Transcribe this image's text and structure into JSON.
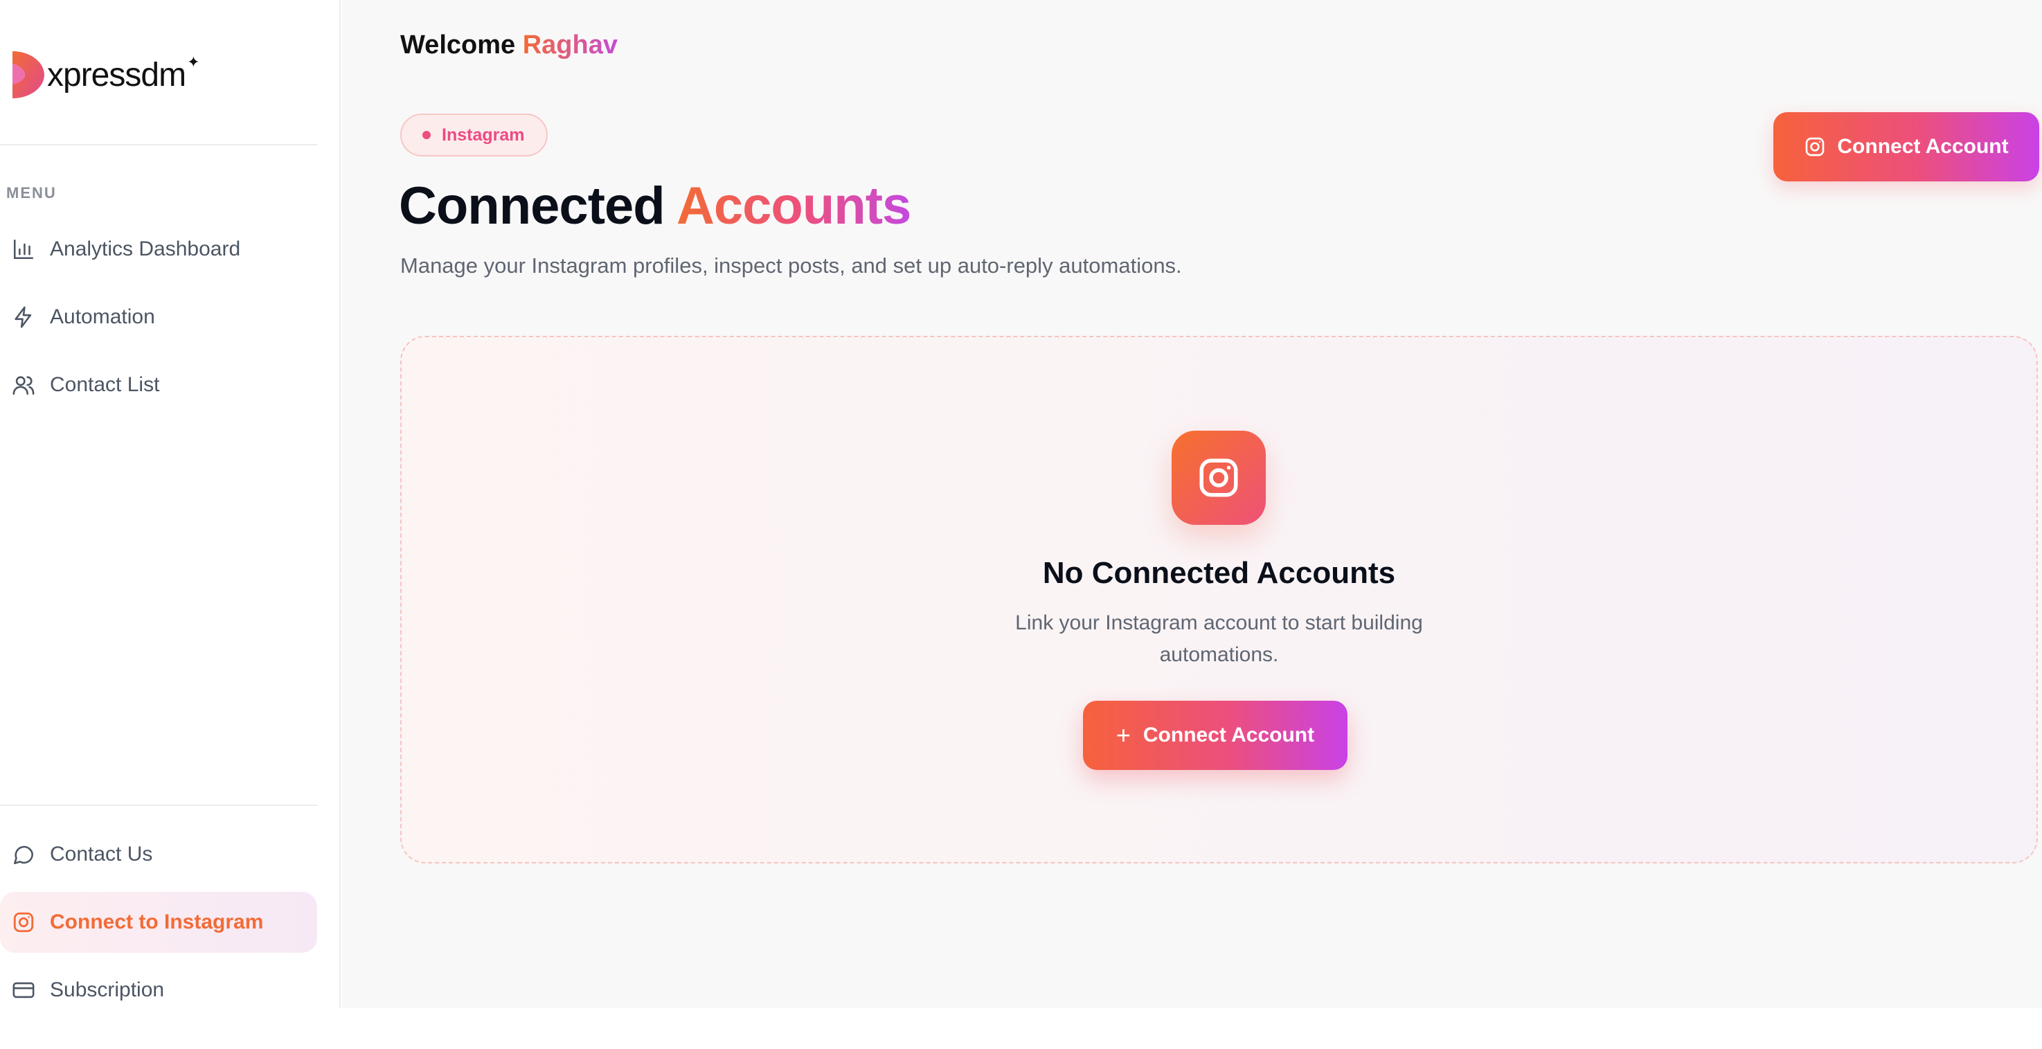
{
  "brand": {
    "name": "xpressdm",
    "spark": "✦"
  },
  "sidebar": {
    "menu_label": "MENU",
    "items": [
      {
        "label": "Analytics Dashboard",
        "icon": "bar-chart-icon"
      },
      {
        "label": "Automation",
        "icon": "lightning-icon"
      },
      {
        "label": "Contact List",
        "icon": "users-icon"
      }
    ],
    "bottom_items": [
      {
        "label": "Contact Us",
        "icon": "chat-bubble-icon"
      },
      {
        "label": "Connect to Instagram",
        "icon": "instagram-icon",
        "active": true
      },
      {
        "label": "Subscription",
        "icon": "credit-card-icon"
      }
    ]
  },
  "header": {
    "welcome": "Welcome",
    "user_name": "Raghav"
  },
  "page": {
    "platform_pill": "Instagram",
    "title_part1": "Connected",
    "title_part2": "Accounts",
    "subtitle": "Manage your Instagram profiles, inspect posts, and set up auto-reply automations.",
    "connect_button": "Connect Account"
  },
  "empty_state": {
    "title": "No Connected Accounts",
    "desc_line1": "Link your Instagram account to start building",
    "desc_line2": "automations.",
    "button_icon": "+",
    "button_label": "Connect Account"
  },
  "colors": {
    "accent_orange": "#f26b36",
    "accent_pink": "#ec4f7d",
    "accent_purple": "#c942e6"
  }
}
